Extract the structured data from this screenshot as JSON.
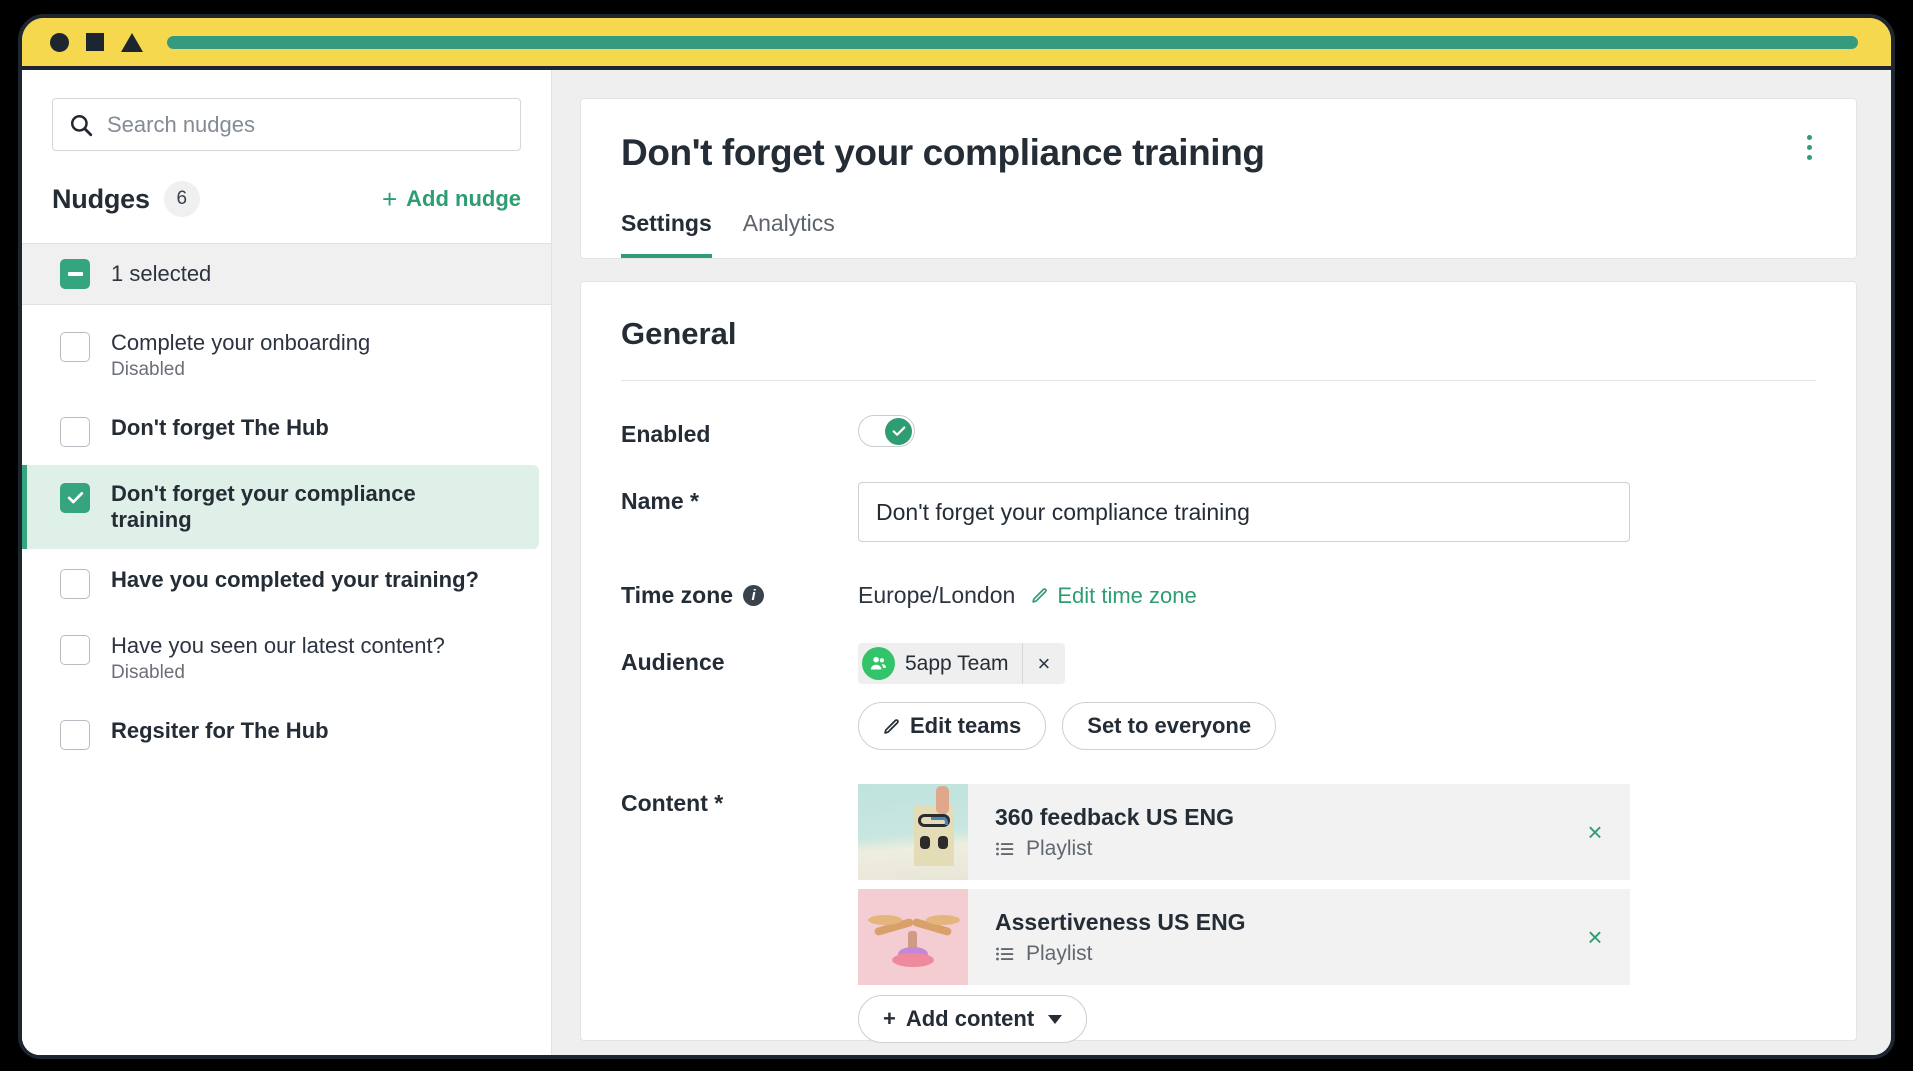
{
  "window": {
    "controls": [
      "circle-shape",
      "square-shape",
      "triangle-shape"
    ],
    "urlbar_color": "#369b7e",
    "titlebar_color": "#f6d84f"
  },
  "sidebar": {
    "search": {
      "placeholder": "Search nudges",
      "value": "",
      "icon": "search-icon"
    },
    "list_title": "Nudges",
    "count": "6",
    "add_button": {
      "plus": "+",
      "label": "Add nudge"
    },
    "selection_bar": {
      "label": "1 selected",
      "state": "indeterminate"
    },
    "items": [
      {
        "name": "Complete your onboarding",
        "status": "Disabled",
        "checked": false,
        "selected": false,
        "bold": false
      },
      {
        "name": "Don't forget The Hub",
        "status": "",
        "checked": false,
        "selected": false,
        "bold": true
      },
      {
        "name": "Don't forget your compliance training",
        "status": "",
        "checked": true,
        "selected": true,
        "bold": true
      },
      {
        "name": "Have you completed your training?",
        "status": "",
        "checked": false,
        "selected": false,
        "bold": true
      },
      {
        "name": "Have you seen our latest content?",
        "status": "Disabled",
        "checked": false,
        "selected": false,
        "bold": false
      },
      {
        "name": "Regsiter for The Hub",
        "status": "",
        "checked": false,
        "selected": false,
        "bold": true
      }
    ]
  },
  "main": {
    "title": "Don't forget your compliance training",
    "kebab_menu": "more-options",
    "tabs": [
      {
        "label": "Settings",
        "active": true
      },
      {
        "label": "Analytics",
        "active": false
      }
    ],
    "section_title": "General",
    "fields": {
      "enabled": {
        "label": "Enabled",
        "value": "on"
      },
      "name": {
        "label": "Name *",
        "value": "Don't forget your compliance training",
        "placeholder": ""
      },
      "timezone": {
        "label": "Time zone",
        "value": "Europe/London",
        "edit_label": "Edit time zone"
      },
      "audience": {
        "label": "Audience",
        "chip": {
          "label": "5app Team",
          "remove": "×"
        },
        "buttons": [
          {
            "label": "Edit teams",
            "icon": "pencil-icon"
          },
          {
            "label": "Set to everyone",
            "icon": ""
          }
        ]
      },
      "content": {
        "label": "Content *",
        "items": [
          {
            "title": "360 feedback US ENG",
            "type": "Playlist",
            "remove": "×",
            "thumb": "teal-blocks"
          },
          {
            "title": "Assertiveness US ENG",
            "type": "Playlist",
            "remove": "×",
            "thumb": "pink-scales"
          }
        ],
        "add_button": {
          "plus": "+",
          "label": "Add content"
        }
      }
    }
  },
  "colors": {
    "accent_green": "#2e9e72",
    "check_green": "#35a57f",
    "avatar_green": "#32c469",
    "selected_bg": "#dff0e8",
    "title_yellow": "#f6d84f",
    "frame_dark": "#1d2630"
  }
}
